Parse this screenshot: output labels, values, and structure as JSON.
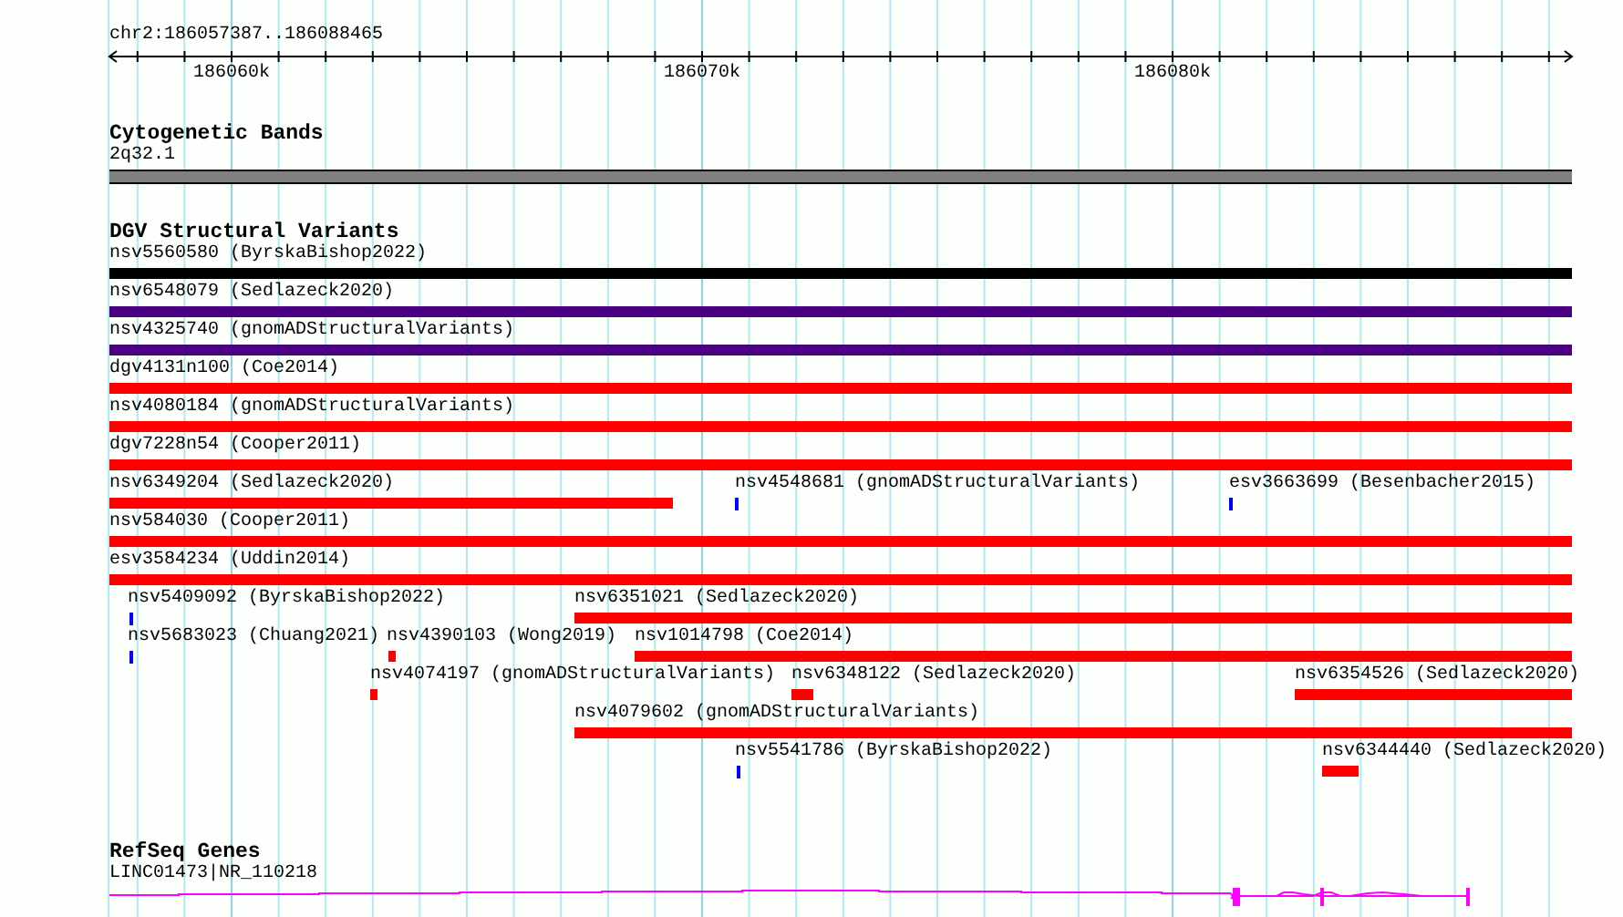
{
  "ruler": {
    "location": "chr2:186057387..186088465",
    "ticks": [
      "186060k",
      "186070k",
      "186080k"
    ]
  },
  "tracks": [
    {
      "kind": "bands",
      "title": "Cytogenetic Bands",
      "features": [
        {
          "label": "2q32.1",
          "color": "#808080"
        }
      ]
    },
    {
      "kind": "variants",
      "title": "DGV Structural Variants",
      "features": [
        {
          "label": "nsv5560580 (ByrskaBishop2022)",
          "color": "#000000"
        },
        {
          "label": "nsv6548079 (Sedlazeck2020)",
          "color": "#4b0082"
        },
        {
          "label": "nsv4325740 (gnomADStructuralVariants)",
          "color": "#4b0082"
        },
        {
          "label": "dgv4131n100 (Coe2014)",
          "color": "#ff0000"
        },
        {
          "label": "nsv4080184 (gnomADStructuralVariants)",
          "color": "#ff0000"
        },
        {
          "label": "dgv7228n54 (Cooper2011)",
          "color": "#ff0000"
        },
        {
          "label": "nsv6349204 (Sedlazeck2020)",
          "color": "#ff0000"
        },
        {
          "label": "nsv4548681 (gnomADStructuralVariants)",
          "color": "#0000ff"
        },
        {
          "label": "esv3663699 (Besenbacher2015)",
          "color": "#0000ff"
        },
        {
          "label": "nsv584030 (Cooper2011)",
          "color": "#ff0000"
        },
        {
          "label": "esv3584234 (Uddin2014)",
          "color": "#ff0000"
        },
        {
          "label": "nsv5409092 (ByrskaBishop2022)",
          "color": "#0000ff"
        },
        {
          "label": "nsv6351021 (Sedlazeck2020)",
          "color": "#ff0000"
        },
        {
          "label": "nsv5683023 (Chuang2021)",
          "color": "#0000ff"
        },
        {
          "label": "nsv4390103 (Wong2019)",
          "color": "#ff0000"
        },
        {
          "label": "nsv1014798 (Coe2014)",
          "color": "#ff0000"
        },
        {
          "label": "nsv4074197 (gnomADStructuralVariants)",
          "color": "#ff0000"
        },
        {
          "label": "nsv6348122 (Sedlazeck2020)",
          "color": "#ff0000"
        },
        {
          "label": "nsv6354526 (Sedlazeck2020)",
          "color": "#ff0000"
        },
        {
          "label": "nsv4079602 (gnomADStructuralVariants)",
          "color": "#ff0000"
        },
        {
          "label": "nsv5541786 (ByrskaBishop2022)",
          "color": "#0000ff"
        },
        {
          "label": "nsv6344440 (Sedlazeck2020)",
          "color": "#ff0000"
        }
      ]
    },
    {
      "kind": "genes",
      "title": "RefSeq Genes",
      "features": [
        {
          "label": "LINC01473|NR_110218",
          "color": "#ff00ff"
        }
      ]
    }
  ]
}
